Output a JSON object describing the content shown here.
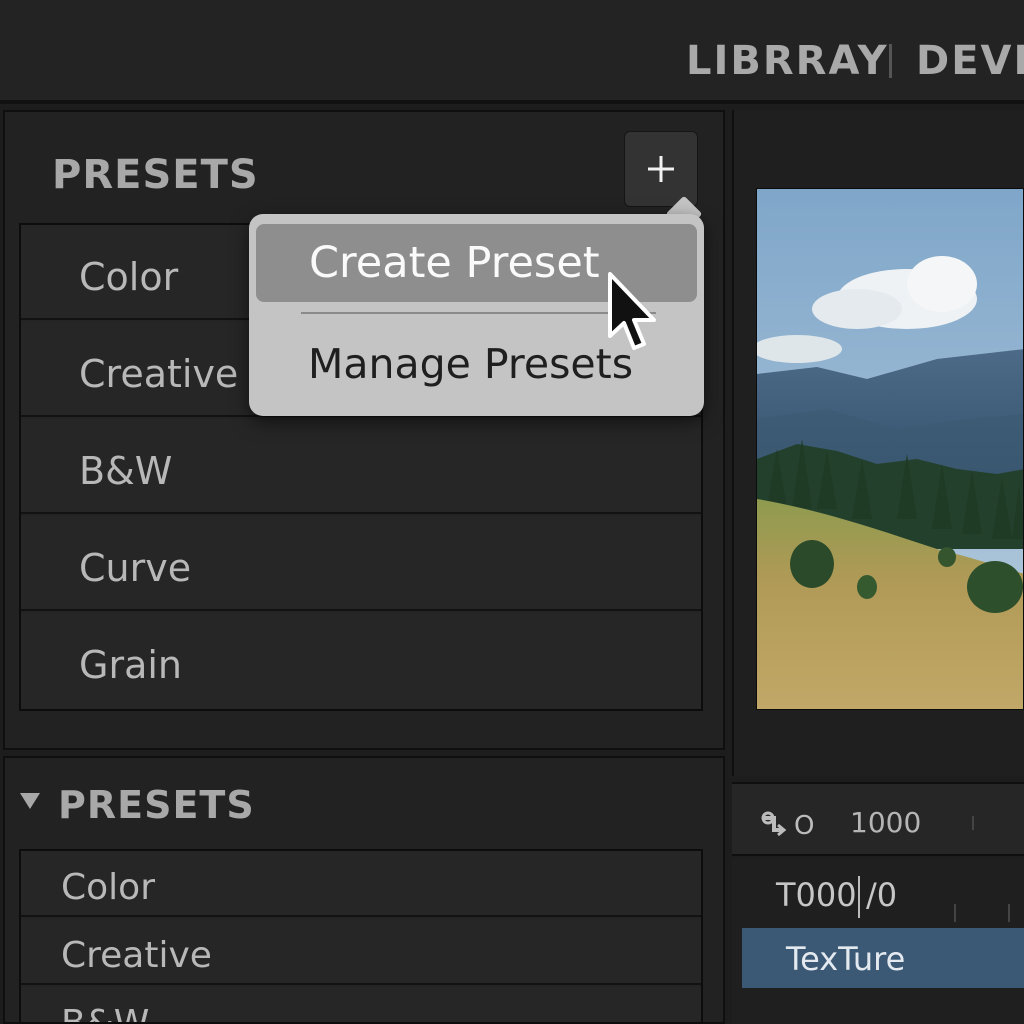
{
  "header": {
    "modules": [
      "LIBRRAY",
      "DEVE"
    ]
  },
  "presets_panel": {
    "title": "PRESETS",
    "add_icon": "plus-icon",
    "items": [
      "Color",
      "Creative",
      "B&W",
      "Curve",
      "Grain"
    ]
  },
  "context_menu": {
    "create_label": "Create Preset",
    "manage_label": "Manage Presets",
    "highlighted": "Create Preset"
  },
  "presets_panel_2": {
    "title": "PRESETS",
    "collapse_icon": "triangle-down-icon",
    "items": [
      "Color",
      "Creative",
      "B&W"
    ]
  },
  "info_bar": {
    "icon": "swap-icon",
    "icon_text": "O",
    "value": "1000"
  },
  "detail": {
    "value": "T000",
    "value2": "/0",
    "selected_row": "TexTure"
  },
  "colors": {
    "accent_selected": "#3b5975",
    "menu_highlight": "#8e8e8e",
    "menu_bg": "#c4c4c4"
  }
}
